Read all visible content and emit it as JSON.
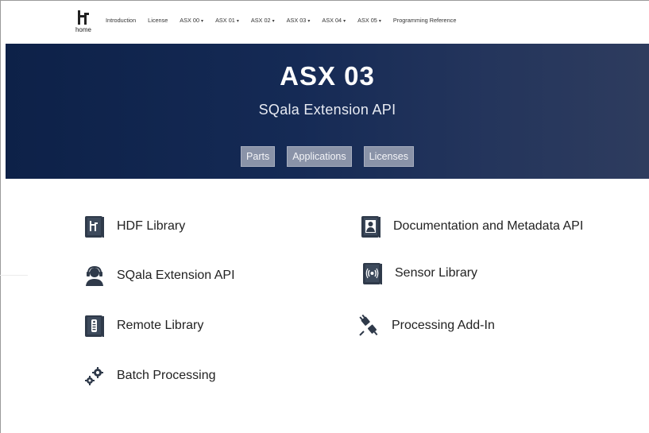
{
  "nav": {
    "logo_label": "home",
    "links": [
      {
        "label": "Introduction",
        "dropdown": false
      },
      {
        "label": "License",
        "dropdown": false
      },
      {
        "label": "ASX 00",
        "dropdown": true
      },
      {
        "label": "ASX 01",
        "dropdown": true
      },
      {
        "label": "ASX 02",
        "dropdown": true
      },
      {
        "label": "ASX 03",
        "dropdown": true
      },
      {
        "label": "ASX 04",
        "dropdown": true
      },
      {
        "label": "ASX 05",
        "dropdown": true
      },
      {
        "label": "Programming Reference",
        "dropdown": false
      }
    ]
  },
  "hero": {
    "title": "ASX 03",
    "subtitle": "SQala Extension API",
    "buttons": [
      "Parts",
      "Applications",
      "Licenses"
    ]
  },
  "items": {
    "hdf": {
      "label": "HDF Library",
      "icon": "hdf-book-icon"
    },
    "sqala": {
      "label": "SQala Extension API",
      "icon": "support-agent-icon"
    },
    "remote": {
      "label": "Remote Library",
      "icon": "remote-book-icon"
    },
    "batch": {
      "label": "Batch Processing",
      "icon": "gears-icon"
    },
    "docs": {
      "label": "Documentation and Metadata API",
      "icon": "person-book-icon"
    },
    "sensor": {
      "label": "Sensor Library",
      "icon": "sensor-book-icon"
    },
    "addin": {
      "label": "Processing Add-In",
      "icon": "plug-icon"
    }
  },
  "colors": {
    "hero_dark": "#0d2148",
    "hero_light": "#2e3c5e",
    "hero_button": "#8a93a8",
    "icon_dark": "#2f3a4a"
  }
}
